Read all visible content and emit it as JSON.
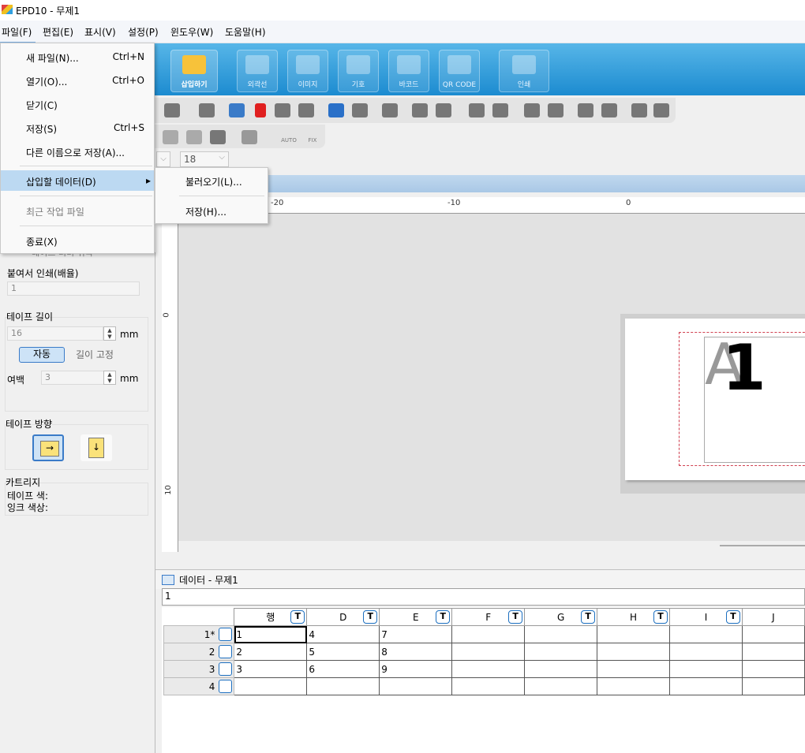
{
  "window": {
    "title": "EPD10 - 무제1"
  },
  "menubar": {
    "items": [
      "파일(F)",
      "편집(E)",
      "표시(V)",
      "설정(P)",
      "윈도우(W)",
      "도움말(H)"
    ]
  },
  "file_menu": {
    "items": [
      {
        "label": "새 파일(N)...",
        "shortcut": "Ctrl+N"
      },
      {
        "label": "열기(O)...",
        "shortcut": "Ctrl+O"
      },
      {
        "label": "닫기(C)",
        "shortcut": ""
      },
      {
        "label": "저장(S)",
        "shortcut": "Ctrl+S"
      },
      {
        "label": "다른 이름으로 저장(A)...",
        "shortcut": ""
      },
      {
        "label": "삽입할 데이터(D)",
        "shortcut": "▸"
      },
      {
        "label": "최근 작업 파일",
        "shortcut": ""
      },
      {
        "label": "종료(X)",
        "shortcut": ""
      }
    ]
  },
  "submenu": {
    "items": [
      {
        "label": "불러오기(L)..."
      },
      {
        "label": "저장(H)..."
      }
    ]
  },
  "ribbon": {
    "buttons": [
      "삽입하기",
      "외곽선",
      "이미지",
      "기호",
      "바코드",
      "QR CODE",
      "인쇄"
    ]
  },
  "toolbar2": {
    "auto_label": "AUTO",
    "fix_label": "FIX"
  },
  "font": {
    "size": "18"
  },
  "rulers": {
    "h_labels": [
      "-20",
      "-10",
      "0"
    ],
    "v_labels": [
      "0",
      "10"
    ]
  },
  "label": {
    "glyph_grey": "A",
    "glyph_black": "1"
  },
  "left_panel": {
    "hidden_button": "테이프 너비 위곡",
    "split_print_label": "붙여서 인쇄(배율)",
    "split_print_value": "1",
    "tape_length_label": "테이프 길이",
    "tape_length_value": "16",
    "unit": "mm",
    "auto_button": "자동",
    "fixed_button": "길이 고정",
    "margin_label": "여백",
    "margin_value": "3",
    "direction_label": "테이프 방향",
    "cartridge_label": "카트리지",
    "tape_color_label": "테이프 색:",
    "ink_color_label": "잉크 색상:"
  },
  "data_panel": {
    "title": "데이터  - 무제1",
    "formula_value": "1",
    "columns": [
      "행",
      "D",
      "E",
      "F",
      "G",
      "H",
      "I",
      "J"
    ],
    "rows": [
      {
        "header": "1*",
        "cells": [
          "1",
          "4",
          "7",
          "",
          "",
          "",
          "",
          ""
        ]
      },
      {
        "header": "2",
        "cells": [
          "2",
          "5",
          "8",
          "",
          "",
          "",
          "",
          ""
        ]
      },
      {
        "header": "3",
        "cells": [
          "3",
          "6",
          "9",
          "",
          "",
          "",
          "",
          ""
        ]
      },
      {
        "header": "4",
        "cells": [
          "",
          "",
          "",
          "",
          "",
          "",
          "",
          ""
        ]
      }
    ]
  },
  "colors": {
    "accent": "#1c8bd0",
    "menu_highlight": "#bcd9f2",
    "print_area": "#d04050"
  }
}
